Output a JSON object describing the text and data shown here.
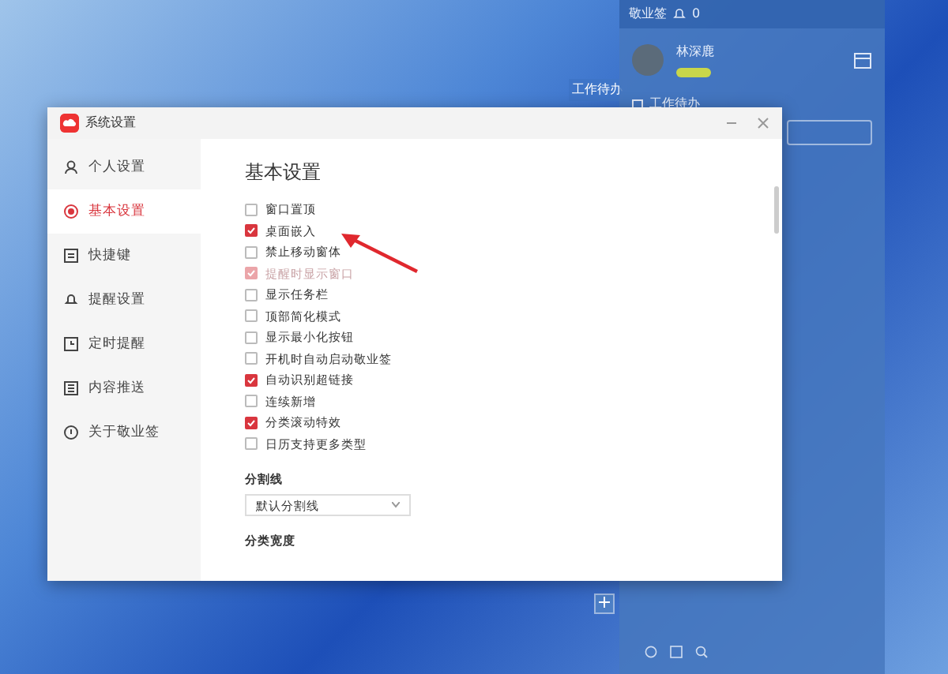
{
  "notes_panel": {
    "title": "敬业签",
    "bell_count": "0",
    "user": {
      "name": "林深鹿"
    },
    "section": {
      "title": "工作待办"
    },
    "side_tab": "工作待办"
  },
  "window": {
    "title": "系统设置",
    "sidebar": {
      "items": [
        {
          "label": "个人设置",
          "selected": false
        },
        {
          "label": "基本设置",
          "selected": true
        },
        {
          "label": "快捷键",
          "selected": false
        },
        {
          "label": "提醒设置",
          "selected": false
        },
        {
          "label": "定时提醒",
          "selected": false
        },
        {
          "label": "内容推送",
          "selected": false
        },
        {
          "label": "关于敬业签",
          "selected": false
        }
      ]
    },
    "content": {
      "heading": "基本设置",
      "options": [
        {
          "label": "窗口置顶",
          "checked": false,
          "disabled": false
        },
        {
          "label": "桌面嵌入",
          "checked": true,
          "disabled": false
        },
        {
          "label": "禁止移动窗体",
          "checked": false,
          "disabled": false
        },
        {
          "label": "提醒时显示窗口",
          "checked": true,
          "disabled": true
        },
        {
          "label": "显示任务栏",
          "checked": false,
          "disabled": false
        },
        {
          "label": "顶部简化模式",
          "checked": false,
          "disabled": false
        },
        {
          "label": "显示最小化按钮",
          "checked": false,
          "disabled": false
        },
        {
          "label": "开机时自动启动敬业签",
          "checked": false,
          "disabled": false
        },
        {
          "label": "自动识别超链接",
          "checked": true,
          "disabled": false
        },
        {
          "label": "连续新增",
          "checked": false,
          "disabled": false
        },
        {
          "label": "分类滚动特效",
          "checked": true,
          "disabled": false
        },
        {
          "label": "日历支持更多类型",
          "checked": false,
          "disabled": false
        }
      ],
      "divider_label": "分割线",
      "divider_select": "默认分割线",
      "width_label": "分类宽度"
    }
  }
}
